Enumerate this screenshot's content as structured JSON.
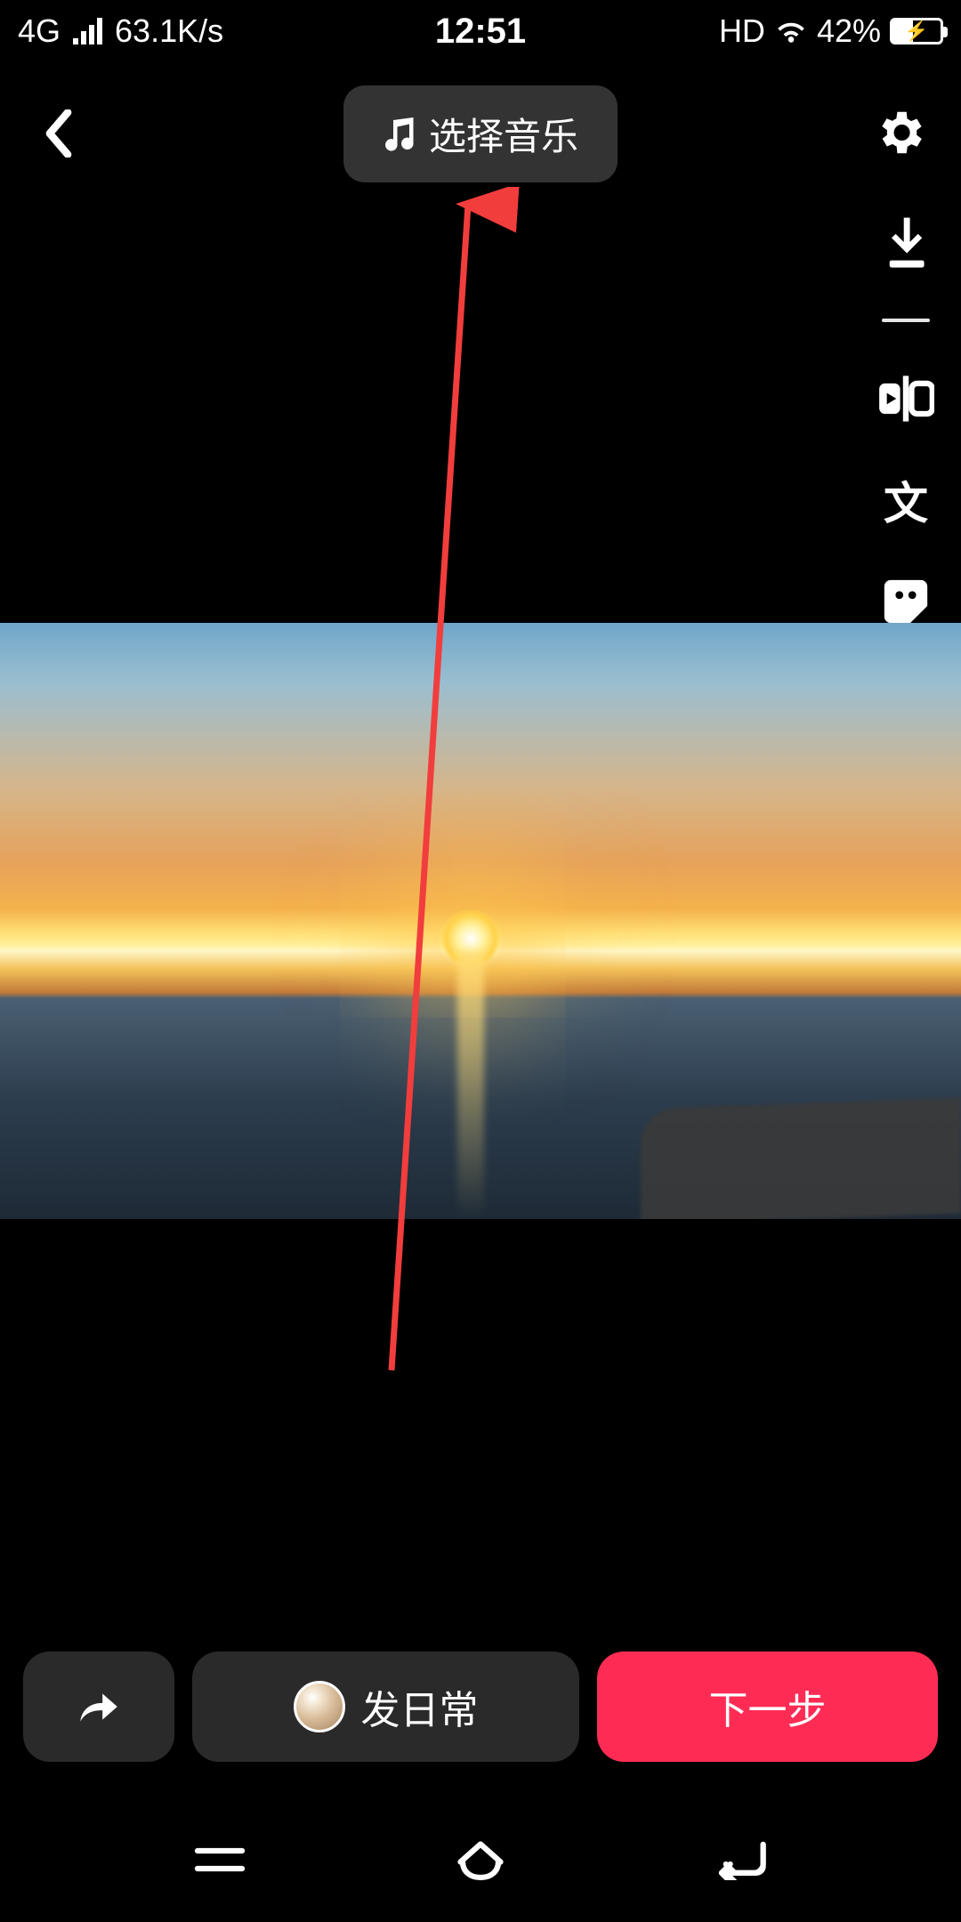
{
  "status": {
    "network": "4G",
    "speed": "63.1K/s",
    "time": "12:51",
    "hd": "HD",
    "battery_pct": "42%"
  },
  "topbar": {
    "music_label": "选择音乐"
  },
  "side_tools": {
    "text_tool": "文"
  },
  "bottom": {
    "daily_label": "发日常",
    "next_label": "下一步"
  },
  "colors": {
    "accent": "#fe2c55",
    "annotation": "#f23d3d"
  }
}
